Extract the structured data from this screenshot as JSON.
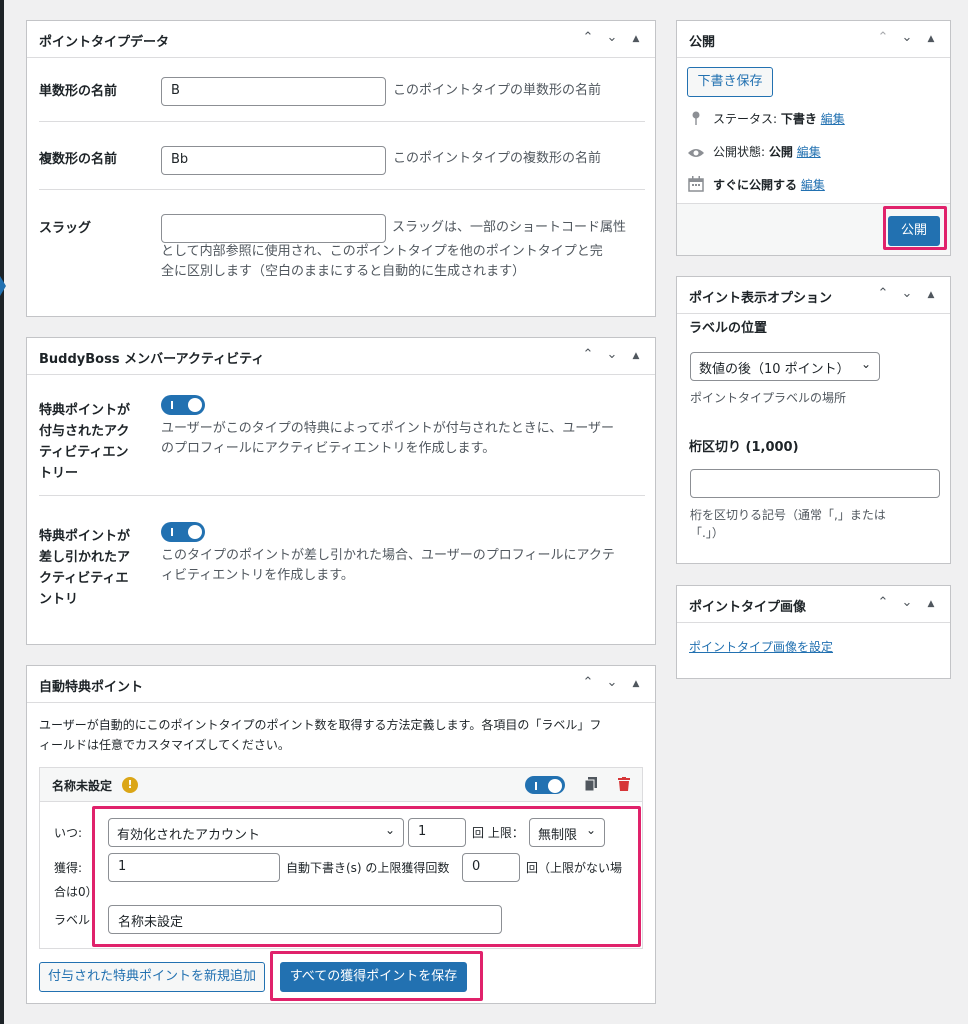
{
  "colors": {
    "accent": "#2271b1",
    "highlight": "#e0226b",
    "warning": "#dba617",
    "danger": "#d63638"
  },
  "point_type_data": {
    "title": "ポイントタイプデータ",
    "singular_label": "単数形の名前",
    "singular_value": "B",
    "singular_desc": "このポイントタイプの単数形の名前",
    "plural_label": "複数形の名前",
    "plural_value": "Bb",
    "plural_desc": "このポイントタイプの複数形の名前",
    "slug_label": "スラッグ",
    "slug_value": "",
    "slug_desc_1": "スラッグは、一部のショートコード属性",
    "slug_desc_2": "として内部参照に使用され、このポイントタイプを他のポイントタイプと完",
    "slug_desc_3": "全に区別します（空白のままにすると自動的に生成されます）"
  },
  "buddyboss": {
    "title": "BuddyBoss メンバーアクティビティ",
    "award_label_1": "特典ポイントが",
    "award_label_2": "付与されたアク",
    "award_label_3": "ティビティエン",
    "award_label_4": "トリー",
    "award_desc_1": "ユーザーがこのタイプの特典によってポイントが付与されたときに、ユーザー",
    "award_desc_2": "のプロフィールにアクティビティエントリを作成します。",
    "deduct_label_1": "特典ポイントが",
    "deduct_label_2": "差し引かれたア",
    "deduct_label_3": "クティビティエ",
    "deduct_label_4": "ントリ",
    "deduct_desc_1": "このタイプのポイントが差し引かれた場合、ユーザーのプロフィールにアクテ",
    "deduct_desc_2": "ィビティエントリを作成します。"
  },
  "auto_award": {
    "title": "自動特典ポイント",
    "intro_1": "ユーザーが自動的にこのポイントタイプのポイント数を取得する方法定義します。各項目の「ラベル」フ",
    "intro_2": "ィールドは任意でカスタマイズしてください。",
    "item_name": "名称未設定",
    "warning_glyph": "!",
    "when_label": "いつ:",
    "when_value": "有効化されたアカウント",
    "count_value": "1",
    "limit_label": "回 上限：",
    "limit_value": "無制限",
    "earn_label": "獲得:",
    "earn_value": "1",
    "max_label": "自動下書き(s) の上限獲得回数",
    "max_value": "0",
    "max_suffix": "回（上限がない場",
    "max_suffix_2": "合は0）",
    "label_label": "ラベル",
    "label_value": "名称未設定",
    "add_button": "付与された特典ポイントを新規追加",
    "save_button": "すべての獲得ポイントを保存"
  },
  "publish": {
    "title": "公開",
    "draft_button": "下書き保存",
    "status_label": "ステータス:",
    "status_value": "下書き",
    "visibility_label": "公開状態:",
    "visibility_value": "公開",
    "schedule_label": "すぐに公開する",
    "edit_link": "編集",
    "publish_button": "公開"
  },
  "display_options": {
    "title": "ポイント表示オプション",
    "label_position_title": "ラベルの位置",
    "label_position_value": "数値の後（10 ポイント）",
    "label_position_desc": "ポイントタイプラベルの場所",
    "separator_title": "桁区切り (1,000)",
    "separator_value": "",
    "separator_desc_1": "桁を区切りる記号（通常「,」または",
    "separator_desc_2": "「.」）"
  },
  "image_box": {
    "title": "ポイントタイプ画像",
    "set_link": "ポイントタイプ画像を設定"
  }
}
